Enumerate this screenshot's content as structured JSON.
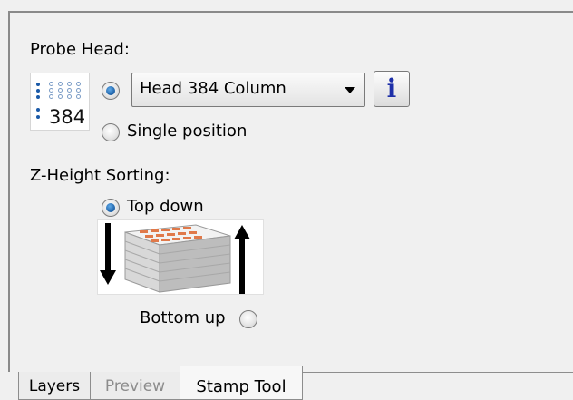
{
  "probe_head": {
    "heading": "Probe Head:",
    "icon_text": "384",
    "head_option_selected": true,
    "head_dropdown_value": "Head 384 Column",
    "info_label": "i",
    "single_position_label": "Single position",
    "single_position_selected": false
  },
  "z_sorting": {
    "heading": "Z-Height Sorting:",
    "top_down_label": "Top down",
    "top_down_selected": true,
    "bottom_up_label": "Bottom up",
    "bottom_up_selected": false
  },
  "tabs": [
    {
      "label": "Layers",
      "state": "normal"
    },
    {
      "label": "Preview",
      "state": "disabled"
    },
    {
      "label": "Stamp Tool",
      "state": "active"
    }
  ],
  "colors": {
    "radio_checked": "#1b5fa5",
    "info_icon": "#1d2fa8",
    "tray_orange": "#e0794a",
    "arrow": "#000000"
  }
}
